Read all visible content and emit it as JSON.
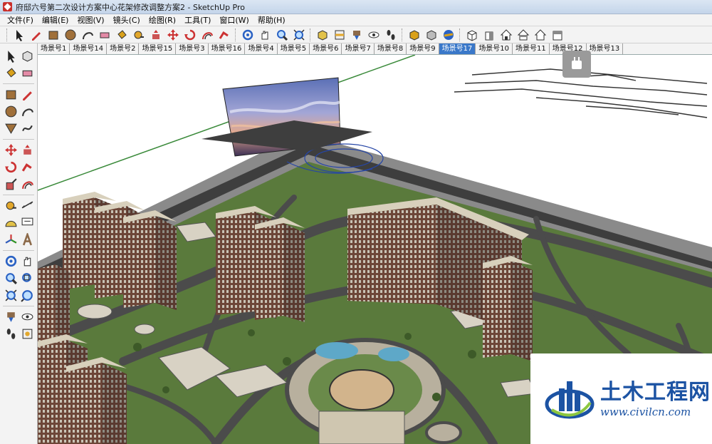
{
  "window": {
    "title": "府邸六号第二次设计方案中心花架修改调整方案2 - SketchUp Pro"
  },
  "menu": [
    "文件(F)",
    "编辑(E)",
    "视图(V)",
    "镜头(C)",
    "绘图(R)",
    "工具(T)",
    "窗口(W)",
    "帮助(H)"
  ],
  "toolbar_icons": [
    "select-icon",
    "pencil-icon",
    "rectangle-icon",
    "circle-icon",
    "arc-icon",
    "eraser-icon",
    "paint-bucket-icon",
    "tape-measure-icon",
    "push-pull-icon",
    "move-icon",
    "rotate-icon",
    "offset-icon",
    "follow-me-icon",
    "orbit-icon",
    "pan-icon",
    "zoom-icon",
    "zoom-extents-icon",
    "components-icon",
    "section-icon",
    "position-camera-icon",
    "look-around-icon",
    "walk-icon",
    "shadow-icon",
    "fog-icon",
    "sandbox-icon",
    "iso-view-icon",
    "front-view-icon",
    "home-view-icon",
    "top-view-icon",
    "right-view-icon",
    "back-view-icon"
  ],
  "scenes": {
    "tabs": [
      "场景号1",
      "场景号14",
      "场景号2",
      "场景号15",
      "场景号3",
      "场景号16",
      "场景号4",
      "场景号5",
      "场景号6",
      "场景号7",
      "场景号8",
      "场景号9",
      "场景号17",
      "场景号10",
      "场景号11",
      "场景号12",
      "场景号13"
    ],
    "active": "场景号17"
  },
  "left_tools": [
    "select-icon",
    "component-icon",
    "paint-icon",
    "eraser-icon",
    "rectangle-icon",
    "line-icon",
    "circle-icon",
    "arc-icon",
    "polygon-icon",
    "freehand-icon",
    "move-icon",
    "push-pull-icon",
    "rotate-icon",
    "follow-me-icon",
    "scale-icon",
    "offset-icon",
    "tape-measure-icon",
    "dimension-icon",
    "protractor-icon",
    "text-icon",
    "axes-icon",
    "3d-text-icon",
    "orbit-icon",
    "pan-icon",
    "zoom-icon",
    "zoom-window-icon",
    "zoom-extents-icon",
    "previous-view-icon",
    "position-camera-icon",
    "look-around-icon",
    "walk-icon",
    "section-plane-icon"
  ],
  "watermark": {
    "name": "土木工程网",
    "url": "www.civilcn.com"
  },
  "colors": {
    "grass": "#5a7a3c",
    "road": "#4b4b4b",
    "building": "#7a4a3a",
    "accent": "#1c53a3",
    "active_tab": "#3a78c9"
  }
}
